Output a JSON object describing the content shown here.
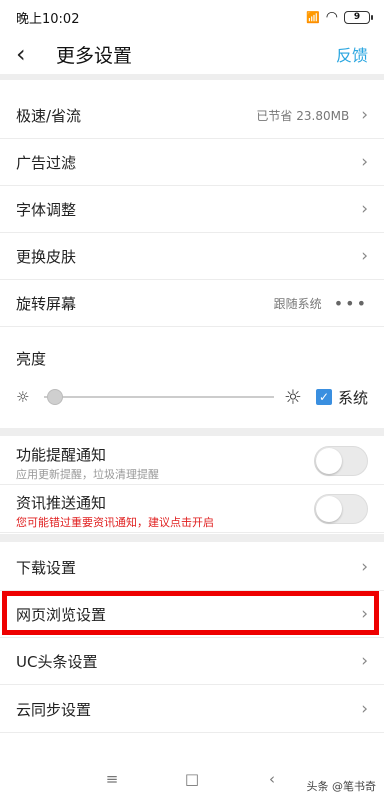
{
  "status_bar": {
    "time": "晚上10:02",
    "signal": "📶",
    "wifi": "◠",
    "battery": "9"
  },
  "header": {
    "back_glyph": "‹",
    "title": "更多设置",
    "feedback": "反馈"
  },
  "rows": [
    {
      "label": "极速/省流",
      "value": "已节省 23.80MB",
      "chevron": "›"
    },
    {
      "label": "广告过滤",
      "chevron": "›"
    },
    {
      "label": "字体调整",
      "chevron": "›"
    },
    {
      "label": "更换皮肤",
      "chevron": "›"
    },
    {
      "label": "旋转屏幕",
      "value": "跟随系统",
      "dots": "•••"
    }
  ],
  "brightness": {
    "title": "亮度",
    "low_icon": "☼",
    "high_icon": "☼",
    "level": 0.05,
    "system_checked": true,
    "check_glyph": "✓",
    "system_label": "系统"
  },
  "toggles": [
    {
      "title": "功能提醒通知",
      "subtitle": "应用更新提醒，垃圾清理提醒",
      "on": false
    },
    {
      "title": "资讯推送通知",
      "subtitle": "您可能错过重要资讯通知，建议点击开启",
      "subtitle_color": "#e02020",
      "on": false
    }
  ],
  "rows2": [
    {
      "label": "下载设置",
      "chevron": "›"
    },
    {
      "label": "网页浏览设置",
      "chevron": "›",
      "highlighted": true
    },
    {
      "label": "UC头条设置",
      "chevron": "›"
    },
    {
      "label": "云同步设置",
      "chevron": "›"
    }
  ],
  "nav_bar": {
    "menu": "≡",
    "home": "□",
    "back": "‹"
  },
  "watermark": "头条 @笔书奇",
  "colors": {
    "accent": "#2aa6e0",
    "highlight_border": "#ee0000",
    "warning_text": "#e02020"
  }
}
